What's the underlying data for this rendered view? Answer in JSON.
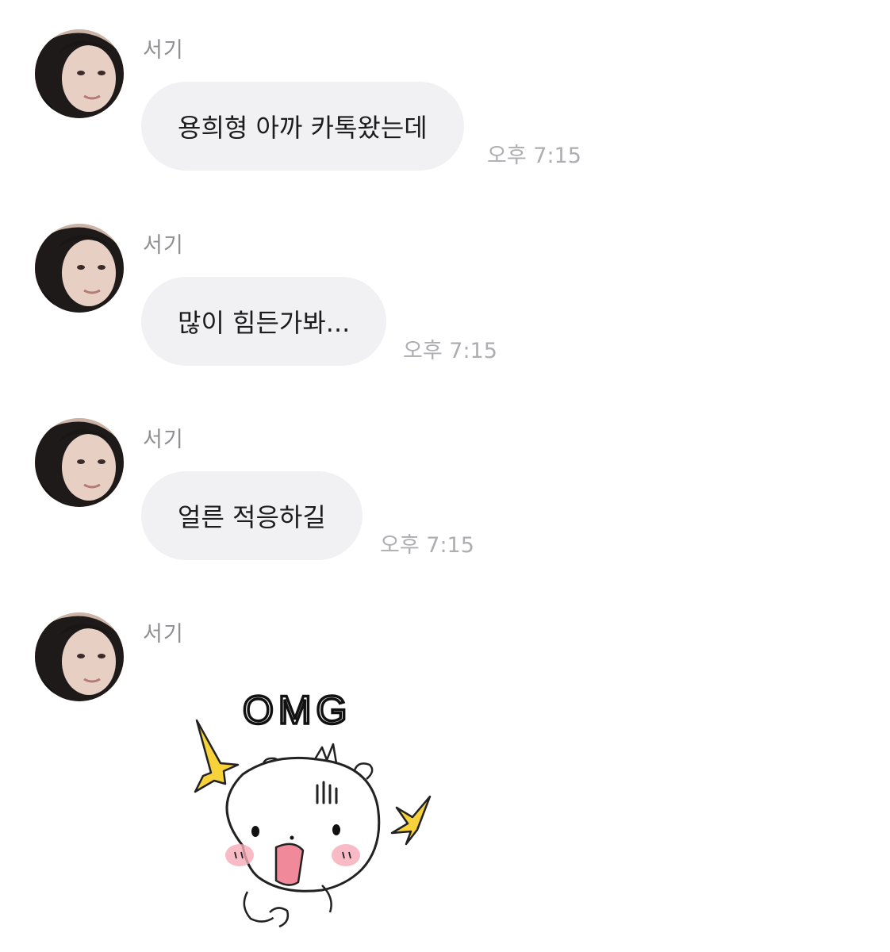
{
  "messages": [
    {
      "sender": "서기",
      "text": "용희형 아까 카톡왔는데",
      "time": "오후 7:15"
    },
    {
      "sender": "서기",
      "text": "많이 힘든가봐...",
      "time": "오후 7:15"
    },
    {
      "sender": "서기",
      "text": "얼른 적응하길",
      "time": "오후 7:15"
    },
    {
      "sender": "서기",
      "sticker": {
        "text": "OMG",
        "icon": "shocked-hamster-sticker"
      }
    }
  ],
  "colors": {
    "bubble": "#f1f1f4",
    "sender": "#8e8e93",
    "time": "#aeaeb2",
    "text": "#1c1c1e",
    "sparkle": "#f7d23b",
    "blush": "#f6a9b5"
  }
}
